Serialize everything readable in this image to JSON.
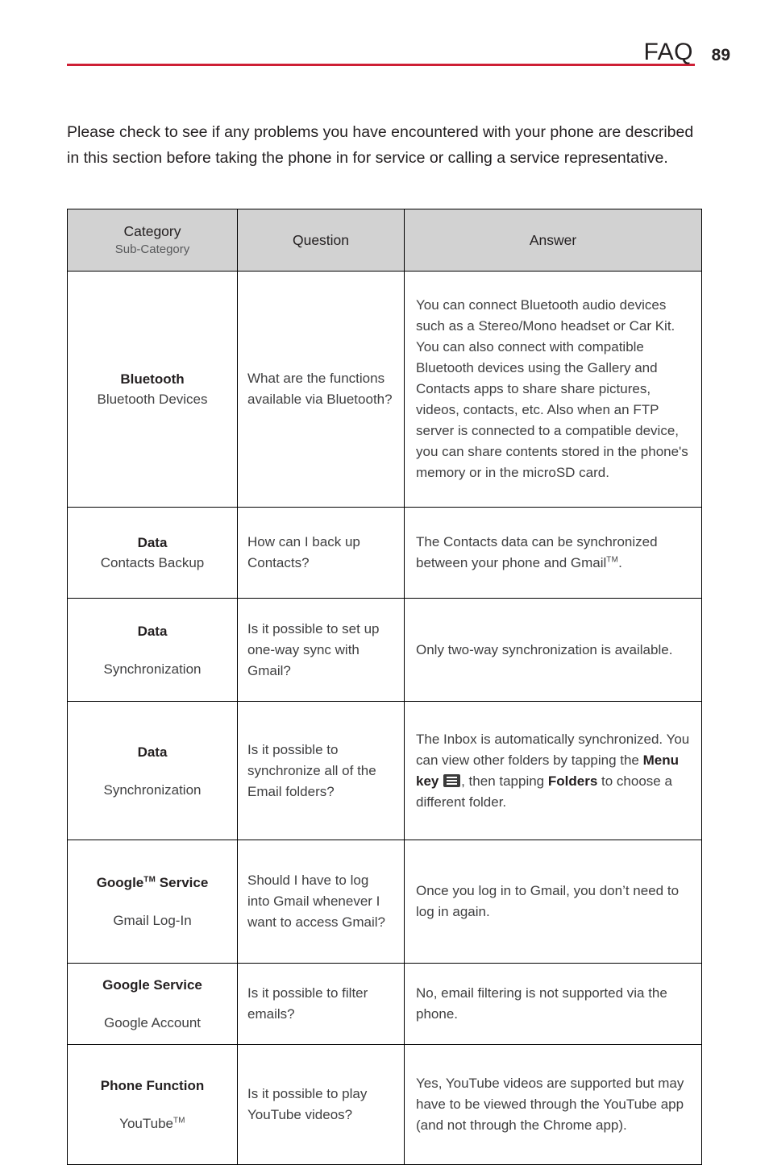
{
  "header": {
    "title": "FAQ",
    "page_number": "89",
    "rule_color": "#ce1f35"
  },
  "intro": {
    "text": "Please check to see if any problems you have encountered with your phone are described in this section before taking the phone in for service or calling a service representative."
  },
  "table": {
    "headers": {
      "category_main": "Category",
      "category_sub": "Sub-Category",
      "question": "Question",
      "answer": "Answer"
    },
    "header_bg": "#d2d2d2",
    "rows": [
      {
        "category": "Bluetooth",
        "subcategory": "Bluetooth Devices",
        "question": "What are the functions available via Bluetooth?",
        "answer": "You can connect Bluetooth audio devices such as a Stereo/Mono headset or Car Kit. You can also connect with compatible Bluetooth devices using the Gallery and Contacts apps to share share pictures, videos, contacts, etc. Also when an FTP server is connected to a compatible device, you can share contents stored in the phone's memory or in the microSD card."
      },
      {
        "category": "Data",
        "subcategory": "Contacts Backup",
        "question": "How can I back up Contacts?",
        "answer_parts": {
          "before": "The Contacts data can be synchronized between your phone and Gmail",
          "tm": "TM",
          "after": "."
        }
      },
      {
        "category": "Data",
        "subcategory": "Synchronization",
        "question": "Is it possible to set up one-way sync with Gmail?",
        "answer": "Only two-way synchronization is available."
      },
      {
        "category": "Data",
        "subcategory": "Synchronization",
        "question": "Is it possible to synchronize all of the Email folders?",
        "answer_parts": {
          "p1": "The Inbox is automatically synchronized. You can view other folders by tapping the ",
          "menu_key_label": "Menu key",
          "icon": "menu-key-icon",
          "p2": ", then tapping ",
          "folders_label": "Folders",
          "p3": " to choose a different folder."
        }
      },
      {
        "category": "Google",
        "category_tm": "TM",
        "category_suffix": " Service",
        "subcategory": "Gmail Log-In",
        "question": "Should I have to log into Gmail whenever I want to access Gmail?",
        "answer": "Once you log in to Gmail, you don’t need to log in again."
      },
      {
        "category": "Google Service",
        "subcategory": "Google Account",
        "question": "Is it possible to filter emails?",
        "answer": "No, email filtering is not supported via the phone."
      },
      {
        "category": "Phone Function",
        "subcategory": "YouTube",
        "subcategory_tm": "TM",
        "question": "Is it possible to play YouTube videos?",
        "answer": "Yes, YouTube videos are supported but may have to be viewed through the YouTube app (and not through the Chrome app)."
      }
    ]
  }
}
